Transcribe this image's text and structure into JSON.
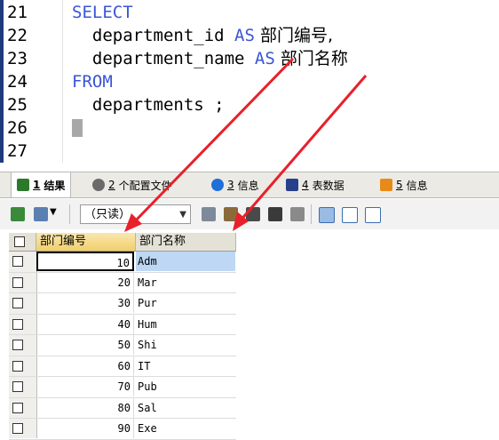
{
  "editor": {
    "lines": [
      {
        "no": "21",
        "parts": [
          {
            "t": "SELECT",
            "c": "kw"
          }
        ]
      },
      {
        "no": "22",
        "parts": [
          {
            "t": "  department_id ",
            "c": "id"
          },
          {
            "t": "AS",
            "c": "kw"
          },
          {
            "t": " 部门编号,",
            "c": "cn"
          }
        ]
      },
      {
        "no": "23",
        "parts": [
          {
            "t": "  department_name ",
            "c": "id"
          },
          {
            "t": "AS",
            "c": "kw"
          },
          {
            "t": " 部门名称",
            "c": "cn"
          }
        ]
      },
      {
        "no": "24",
        "parts": [
          {
            "t": "FROM",
            "c": "kw"
          }
        ]
      },
      {
        "no": "25",
        "parts": [
          {
            "t": "  departments ;",
            "c": "id"
          }
        ]
      },
      {
        "no": "26",
        "parts": []
      },
      {
        "no": "27",
        "parts": []
      }
    ]
  },
  "tabs": [
    {
      "num": "1",
      "label": "结果",
      "icon": "result-grid-icon",
      "color": "#2b7a2b"
    },
    {
      "num": "2",
      "label": "个配置文件",
      "icon": "profile-icon",
      "color": "#6b6b6b"
    },
    {
      "num": "3",
      "label": "信息",
      "icon": "info-icon",
      "color": "#1e6fd9"
    },
    {
      "num": "4",
      "label": "表数据",
      "icon": "table-data-icon",
      "color": "#27408b"
    },
    {
      "num": "5",
      "label": "信息",
      "icon": "info-colored-icon",
      "color": "#e88a1a"
    }
  ],
  "toolbar": {
    "mode_select": "（只读）"
  },
  "grid": {
    "columns": [
      "部门编号",
      "部门名称"
    ],
    "rows": [
      {
        "id": "10",
        "name": "Adm"
      },
      {
        "id": "20",
        "name": "Mar"
      },
      {
        "id": "30",
        "name": "Pur"
      },
      {
        "id": "40",
        "name": "Hum"
      },
      {
        "id": "50",
        "name": "Shi"
      },
      {
        "id": "60",
        "name": "IT"
      },
      {
        "id": "70",
        "name": "Pub"
      },
      {
        "id": "80",
        "name": "Sal"
      },
      {
        "id": "90",
        "name": "Exe"
      }
    ]
  },
  "colors": {
    "keyword": "#3a55d6",
    "annotation_arrow": "#e8202a",
    "selection": "#bdd7f4"
  }
}
